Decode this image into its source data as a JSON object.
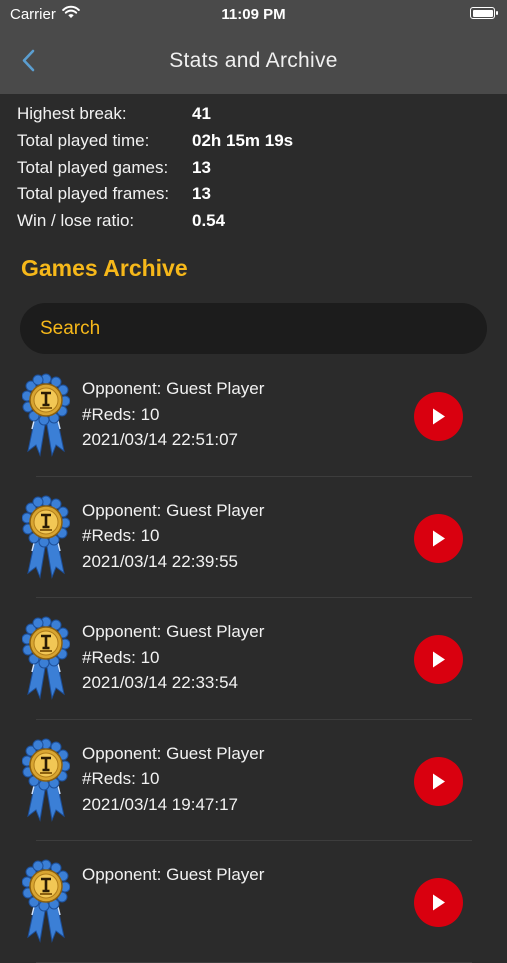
{
  "status_bar": {
    "carrier": "Carrier",
    "time": "11:09 PM"
  },
  "nav": {
    "title": "Stats and Archive"
  },
  "stats": [
    {
      "label": "Highest break:",
      "value": "41"
    },
    {
      "label": "Total played time:",
      "value": "02h 15m 19s"
    },
    {
      "label": "Total played games:",
      "value": "13"
    },
    {
      "label": "Total played frames:",
      "value": "13"
    },
    {
      "label": "Win / lose ratio:",
      "value": "0.54"
    }
  ],
  "archive": {
    "title": "Games Archive",
    "search_placeholder": "Search",
    "games": [
      {
        "opponent": "Opponent: Guest Player",
        "reds": "#Reds: 10",
        "datetime": "2021/03/14 22:51:07"
      },
      {
        "opponent": "Opponent: Guest Player",
        "reds": "#Reds: 10",
        "datetime": "2021/03/14 22:39:55"
      },
      {
        "opponent": "Opponent: Guest Player",
        "reds": "#Reds: 10",
        "datetime": "2021/03/14 22:33:54"
      },
      {
        "opponent": "Opponent: Guest Player",
        "reds": "#Reds: 10",
        "datetime": "2021/03/14 19:47:17"
      },
      {
        "opponent": "Opponent: Guest Player",
        "reds": "",
        "datetime": ""
      }
    ]
  },
  "colors": {
    "accent": "#f6b81a",
    "play": "#d9000f",
    "background": "#2b2b2b",
    "bar": "#4a4a4a"
  },
  "icons": {
    "back": "chevron-left-icon",
    "medal": "medal-ribbon-icon",
    "play": "play-icon"
  }
}
